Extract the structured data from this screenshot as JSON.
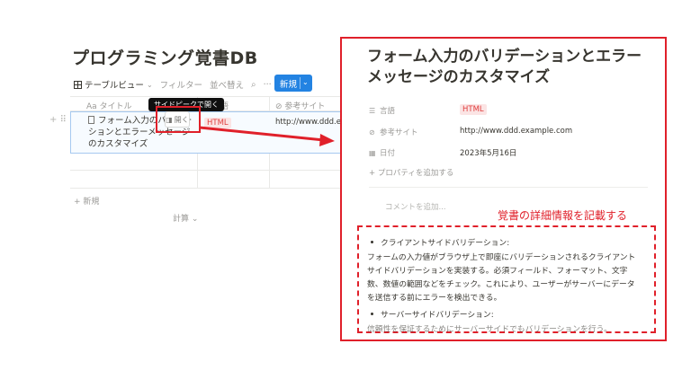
{
  "database": {
    "title": "プログラミング覚書DB",
    "toolbar": {
      "view_label": "テーブルビュー",
      "filter_label": "フィルター",
      "sort_label": "並べ替え",
      "new_label": "新規"
    },
    "columns": [
      "Aa タイトル",
      "言語",
      "参考サイト"
    ],
    "rows": [
      {
        "title": "フォーム入力のバリデーションとエラーメッセージのカスタマイズ",
        "language": "HTML",
        "url": "http://www.ddd.ex"
      }
    ],
    "tooltip": "サイドピークで開く",
    "open_button": "開く",
    "add_row": "+ 新規",
    "calculate": "計算"
  },
  "peek": {
    "title": "フォーム入力のバリデーションとエラーメッセージのカスタマイズ",
    "properties": [
      {
        "label": "言語",
        "value": "HTML",
        "icon": "list-icon"
      },
      {
        "label": "参考サイト",
        "value": "http://www.ddd.example.com",
        "icon": "link-icon"
      },
      {
        "label": "日付",
        "value": "2023年5月16日",
        "icon": "calendar-icon"
      }
    ],
    "add_property": "+ プロパティを追加する",
    "comment_placeholder": "コメントを追加...",
    "body": {
      "bullet1": "クライアントサイドバリデーション:",
      "paragraph1": "フォームの入力値がブラウザ上で即座にバリデーションされるクライアントサイドバリデーションを実装する。必須フィールド、フォーマット、文字数、数値の範囲などをチェック。これにより、ユーザーがサーバーにデータを送信する前にエラーを検出できる。",
      "bullet2": "サーバーサイドバリデーション:",
      "paragraph2_partial": "信頼性を保証するためにサーバーサイドでもバリデーションを行う。"
    }
  },
  "annotation": "覚書の詳細情報を記載する",
  "colors": {
    "accent": "#2383e2",
    "annotation_red": "#e0202a",
    "tag_bg": "#fbe4e4",
    "tag_text": "#e03e3e"
  }
}
